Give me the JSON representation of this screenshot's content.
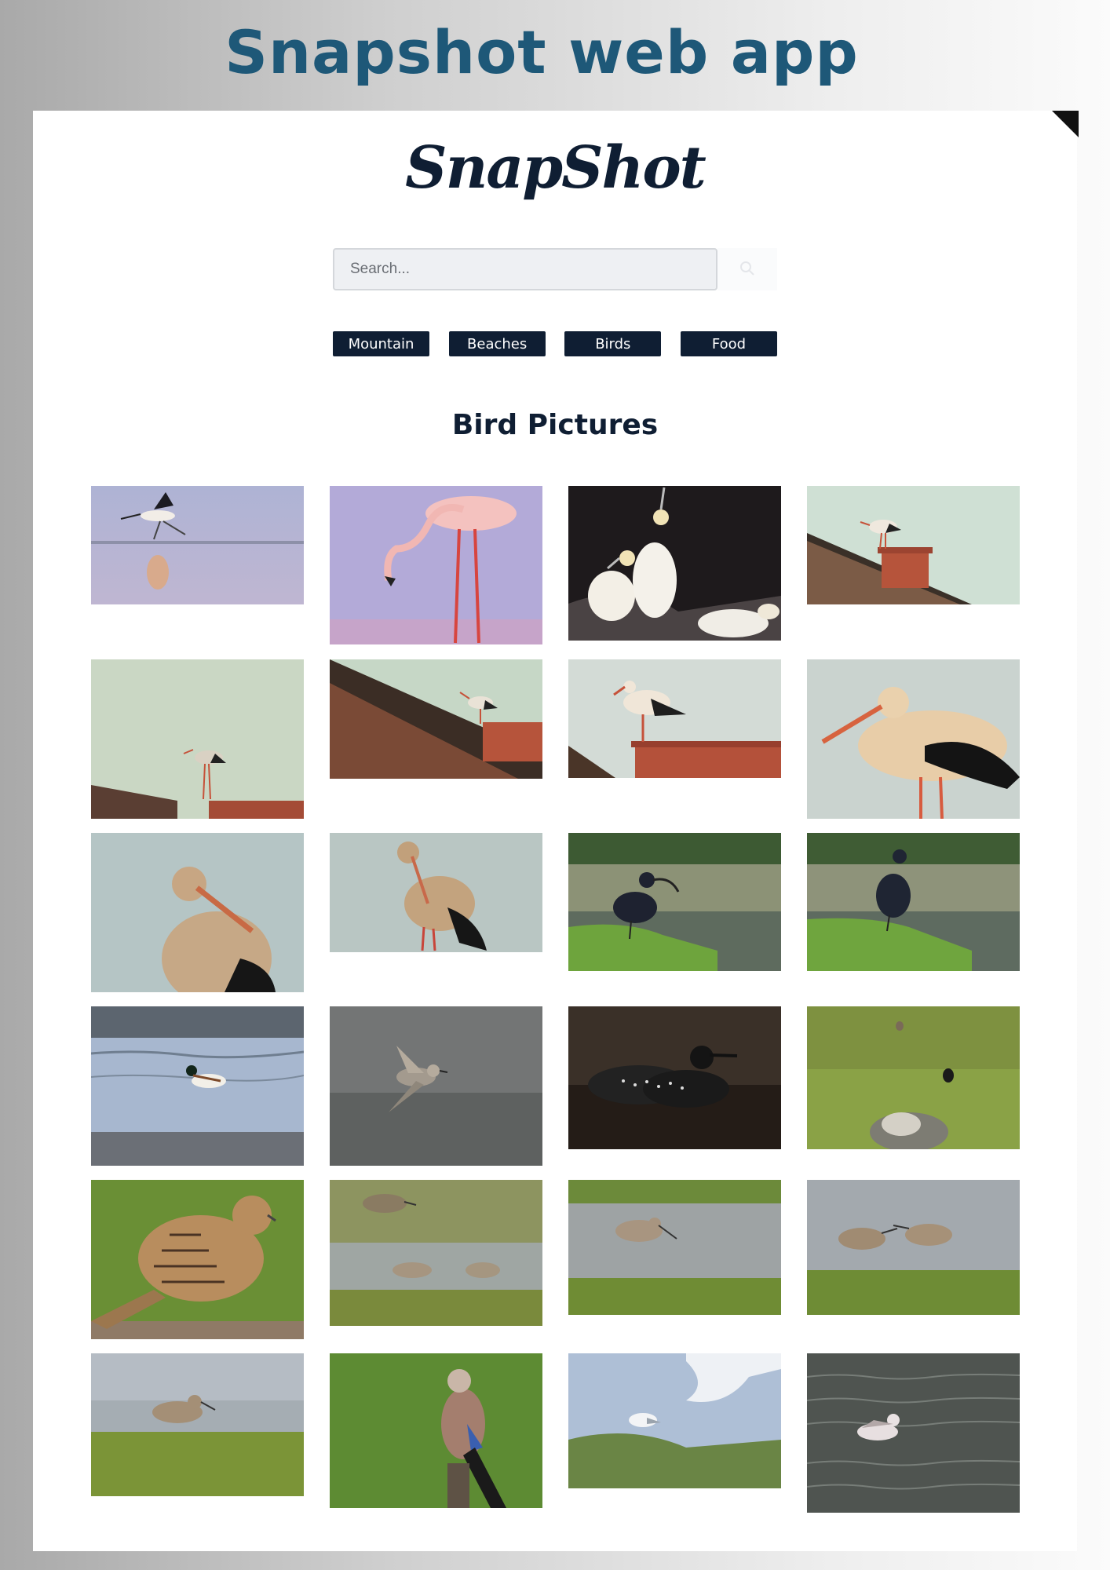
{
  "page": {
    "banner_title": "Snapshot web app"
  },
  "app": {
    "logo": "SnapShot",
    "search": {
      "placeholder": "Search...",
      "value": ""
    },
    "categories": [
      "Mountain",
      "Beaches",
      "Birds",
      "Food"
    ],
    "section_title": "Bird Pictures"
  },
  "colors": {
    "brand_navy": "#0f1e33",
    "banner_blue": "#1e5878"
  },
  "icons": [
    "search-icon"
  ],
  "photos": [
    {
      "subject": "avocet"
    },
    {
      "subject": "flamingo"
    },
    {
      "subject": "gannets"
    },
    {
      "subject": "stork-on-chimney"
    },
    {
      "subject": "stork-on-roof"
    },
    {
      "subject": "stork-on-roof-edge"
    },
    {
      "subject": "stork-on-chimney"
    },
    {
      "subject": "stork-closeup"
    },
    {
      "subject": "stork-portrait"
    },
    {
      "subject": "stork-standing"
    },
    {
      "subject": "ibis"
    },
    {
      "subject": "ibis"
    },
    {
      "subject": "shelduck"
    },
    {
      "subject": "sandpiper-in-flight"
    },
    {
      "subject": "loon"
    },
    {
      "subject": "birds-in-grass"
    },
    {
      "subject": "kestrel"
    },
    {
      "subject": "sandpipers"
    },
    {
      "subject": "sandpiper"
    },
    {
      "subject": "sandpipers"
    },
    {
      "subject": "sandpiper"
    },
    {
      "subject": "jay"
    },
    {
      "subject": "gull"
    },
    {
      "subject": "gull-on-water"
    }
  ]
}
